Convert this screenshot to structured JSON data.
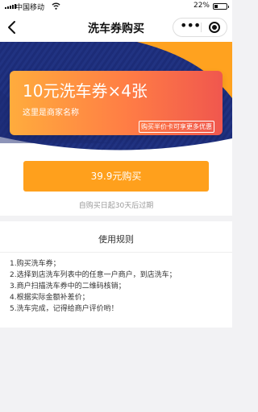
{
  "status_bar": {
    "carrier": "中国移动",
    "battery": "22%"
  },
  "nav": {
    "title": "洗车券购买",
    "more_glyph": "•••"
  },
  "coupon": {
    "name": "10元洗车券×4张",
    "merchant": "这里是商家名称",
    "promo": "购买半价卡可享更多优惠"
  },
  "purchase": {
    "button_label": "39.9元购买",
    "expire_note": "自购买日起30天后过期"
  },
  "rules": {
    "title": "使用规则",
    "items": [
      "1.购买洗车券；",
      "2.选择到店洗车列表中的任意一户商户，到店洗车；",
      "3.商户扫描洗车券中的二维码核销；",
      "4.根据实际金额补差价；",
      "5.洗车完成，记得给商户评价哟！"
    ]
  },
  "colors": {
    "hero_navy": "#1f2f80",
    "hero_orange": "#ffa21f",
    "button": "#ffa01c"
  }
}
